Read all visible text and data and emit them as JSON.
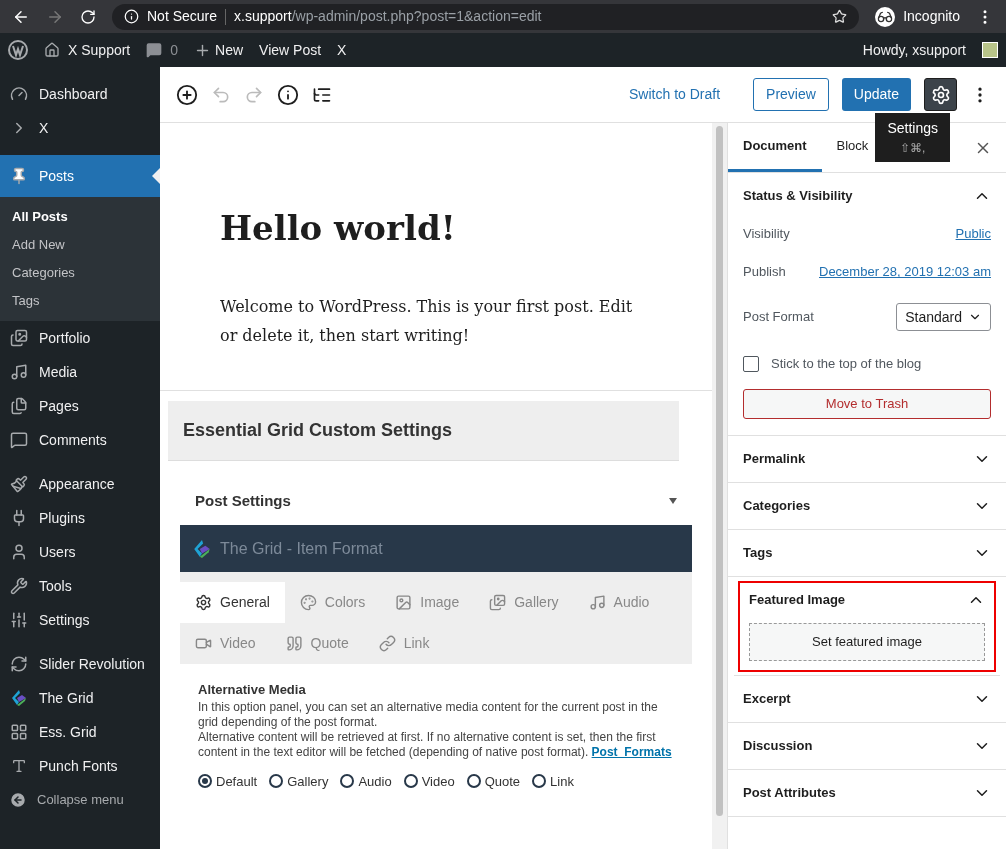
{
  "browser": {
    "security": "Not Secure",
    "url_host": "x.support",
    "url_path": "/wp-admin/post.php?post=1&action=edit",
    "profile": "Incognito"
  },
  "admin_bar": {
    "site": "X Support",
    "comments": "0",
    "new": "New",
    "view_post": "View Post",
    "x": "X",
    "howdy": "Howdy, xsupport"
  },
  "sidebar": {
    "sections": [
      {
        "items": [
          {
            "label": "Dashboard",
            "selected": false
          },
          {
            "label": "X",
            "selected": false
          }
        ]
      },
      {
        "items": [
          {
            "label": "Posts",
            "selected": true,
            "children": [
              {
                "label": "All Posts",
                "selected": true
              },
              {
                "label": "Add New",
                "selected": false
              },
              {
                "label": "Categories",
                "selected": false
              },
              {
                "label": "Tags",
                "selected": false
              }
            ]
          },
          {
            "label": "Portfolio",
            "selected": false
          },
          {
            "label": "Media",
            "selected": false
          },
          {
            "label": "Pages",
            "selected": false
          },
          {
            "label": "Comments",
            "selected": false
          }
        ]
      },
      {
        "items": [
          {
            "label": "Appearance",
            "selected": false
          },
          {
            "label": "Plugins",
            "selected": false
          },
          {
            "label": "Users",
            "selected": false
          },
          {
            "label": "Tools",
            "selected": false
          },
          {
            "label": "Settings",
            "selected": false
          }
        ]
      },
      {
        "items": [
          {
            "label": "Slider Revolution",
            "selected": false
          },
          {
            "label": "The Grid",
            "selected": false
          },
          {
            "label": "Ess. Grid",
            "selected": false
          },
          {
            "label": "Punch Fonts",
            "selected": false
          }
        ]
      }
    ],
    "collapse": "Collapse menu"
  },
  "toolbar": {
    "switch_to_draft": "Switch to Draft",
    "preview": "Preview",
    "update": "Update",
    "settings_pressed": true,
    "tooltip": {
      "title": "Settings",
      "shortcut": "⇧⌘,"
    }
  },
  "post": {
    "title": "Hello world!",
    "paragraph": "Welcome to WordPress. This is your first post. Edit or delete it, then start writing!"
  },
  "metabox": {
    "title": "Essential Grid Custom Settings",
    "post_settings": "Post Settings",
    "grid_header": "The Grid - Item Format",
    "tabs": [
      {
        "label": "General",
        "selected": true
      },
      {
        "label": "Colors",
        "selected": false
      },
      {
        "label": "Image",
        "selected": false
      },
      {
        "label": "Gallery",
        "selected": false
      },
      {
        "label": "Audio",
        "selected": false
      },
      {
        "label": "Video",
        "selected": false
      },
      {
        "label": "Quote",
        "selected": false
      },
      {
        "label": "Link",
        "selected": false
      }
    ],
    "section_title": "Alternative Media",
    "description": [
      "In this option panel, you can set an alternative media content for the current post in the grid depending of the post format.",
      "Alternative content will be retrieved at first. If no alternative content is set, then the first content in the text editor will be fetched (depending of native post format)."
    ],
    "link": "Post_Formats",
    "radios": [
      {
        "label": "Default",
        "selected": true
      },
      {
        "label": "Gallery",
        "selected": false
      },
      {
        "label": "Audio",
        "selected": false
      },
      {
        "label": "Video",
        "selected": false
      },
      {
        "label": "Quote",
        "selected": false
      },
      {
        "label": "Link",
        "selected": false
      }
    ]
  },
  "settings_panel": {
    "tabs": [
      {
        "label": "Document",
        "selected": true
      },
      {
        "label": "Block",
        "selected": false
      }
    ],
    "status": {
      "title": "Status & Visibility",
      "expanded": true,
      "visibility_label": "Visibility",
      "visibility": "Public",
      "publish_label": "Publish",
      "publish": "December 28, 2019 12:03 am",
      "format_label": "Post Format",
      "format": "Standard",
      "sticky_label": "Stick to the top of the blog",
      "sticky": false,
      "trash": "Move to Trash"
    },
    "panels": [
      {
        "title": "Permalink",
        "expanded": false,
        "highlighted": false
      },
      {
        "title": "Categories",
        "expanded": false,
        "highlighted": false
      },
      {
        "title": "Tags",
        "expanded": false,
        "highlighted": false
      },
      {
        "title": "Featured Image",
        "expanded": true,
        "highlighted": true,
        "button": "Set featured image"
      },
      {
        "title": "Excerpt",
        "expanded": false,
        "highlighted": false
      },
      {
        "title": "Discussion",
        "expanded": false,
        "highlighted": false
      },
      {
        "title": "Post Attributes",
        "expanded": false,
        "highlighted": false
      }
    ]
  }
}
